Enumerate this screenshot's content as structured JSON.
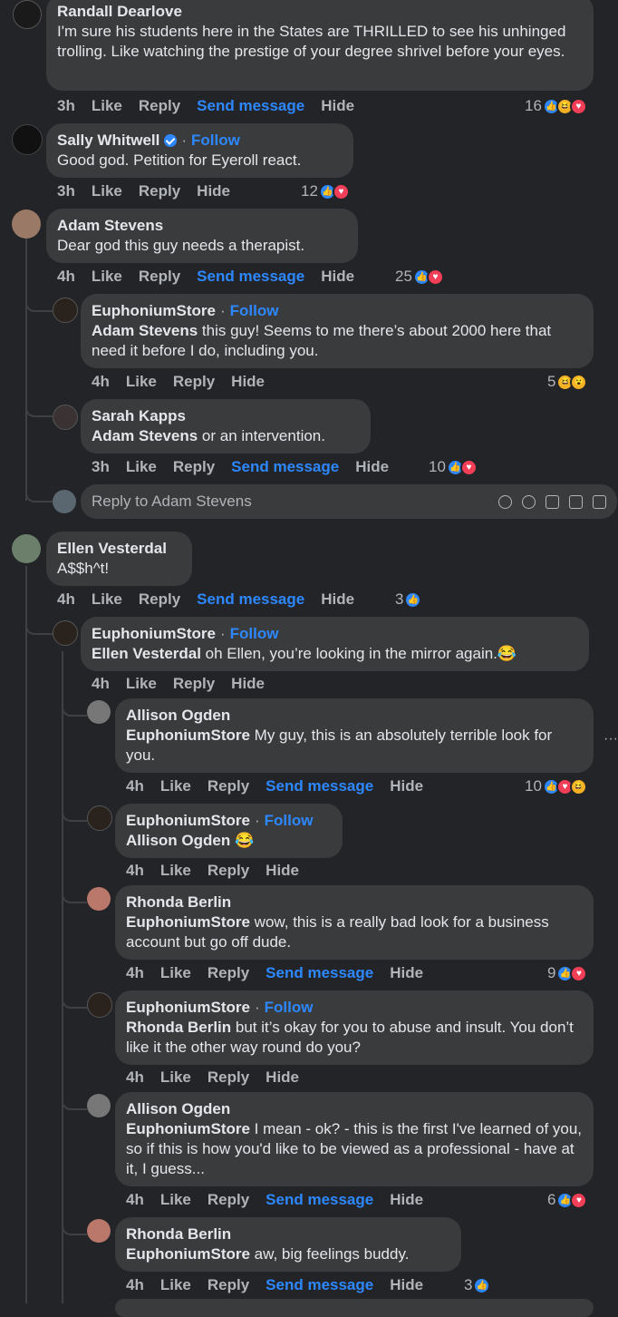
{
  "comments": [
    {
      "name": "Randall Dearlove",
      "text": "I'm sure his students here in the States are THRILLED to see his unhinged trolling. Like watching the prestige of your degree shrivel before your eyes.",
      "time": "3h",
      "like": "Like",
      "reply": "Reply",
      "send": "Send message",
      "hide": "Hide",
      "reactions": "16"
    },
    {
      "name": "Sally Whitwell",
      "follow": "Follow",
      "text": "Good god. Petition for Eyeroll react.",
      "time": "3h",
      "like": "Like",
      "reply": "Reply",
      "hide": "Hide",
      "reactions": "12"
    },
    {
      "name": "Adam Stevens",
      "text": "Dear god this guy needs a therapist.",
      "time": "4h",
      "like": "Like",
      "reply": "Reply",
      "send": "Send message",
      "hide": "Hide",
      "reactions": "25"
    },
    {
      "name": "EuphoniumStore",
      "follow": "Follow",
      "mention": "Adam Stevens",
      "text": " this guy! Seems to me there’s about 2000 here that need it before I do, including you.",
      "time": "4h",
      "like": "Like",
      "reply": "Reply",
      "hide": "Hide",
      "reactions": "5"
    },
    {
      "name": "Sarah Kapps",
      "mention": "Adam Stevens",
      "text": " or an intervention.",
      "time": "3h",
      "like": "Like",
      "reply": "Reply",
      "send": "Send message",
      "hide": "Hide",
      "reactions": "10"
    },
    {
      "name": "Ellen Vesterdal",
      "text": "A$$h^t!",
      "time": "4h",
      "like": "Like",
      "reply": "Reply",
      "send": "Send message",
      "hide": "Hide",
      "reactions": "3"
    },
    {
      "name": "EuphoniumStore",
      "follow": "Follow",
      "mention": "Ellen Vesterdal",
      "text": " oh Ellen, you’re looking in the mirror again.😂",
      "time": "4h",
      "like": "Like",
      "reply": "Reply",
      "hide": "Hide"
    },
    {
      "name": "Allison Ogden",
      "mention": "EuphoniumStore",
      "text": " My guy, this is an absolutely terrible look for you.",
      "time": "4h",
      "like": "Like",
      "reply": "Reply",
      "send": "Send message",
      "hide": "Hide",
      "reactions": "10"
    },
    {
      "name": "EuphoniumStore",
      "follow": "Follow",
      "mention": "Allison Ogden",
      "text": " 😂",
      "time": "4h",
      "like": "Like",
      "reply": "Reply",
      "hide": "Hide"
    },
    {
      "name": "Rhonda Berlin",
      "mention": "EuphoniumStore",
      "text": " wow, this is a really bad look for a business account but go off dude.",
      "time": "4h",
      "like": "Like",
      "reply": "Reply",
      "send": "Send message",
      "hide": "Hide",
      "reactions": "9"
    },
    {
      "name": "EuphoniumStore",
      "follow": "Follow",
      "mention": "Rhonda Berlin",
      "text": " but it’s okay for you to abuse and insult. You don’t like it the other way round do you?",
      "time": "4h",
      "like": "Like",
      "reply": "Reply",
      "hide": "Hide"
    },
    {
      "name": "Allison Ogden",
      "mention": "EuphoniumStore",
      "text": " I mean - ok? - this is the first I've learned of you, so if this is how you'd like to be viewed as a professional - have at it, I guess...",
      "time": "4h",
      "like": "Like",
      "reply": "Reply",
      "send": "Send message",
      "hide": "Hide",
      "reactions": "6"
    },
    {
      "name": "Rhonda Berlin",
      "mention": "EuphoniumStore",
      "text": " aw, big feelings buddy.",
      "time": "4h",
      "like": "Like",
      "reply": "Reply",
      "send": "Send message",
      "hide": "Hide",
      "reactions": "3"
    }
  ],
  "reply_box": {
    "placeholder": "Reply to Adam Stevens"
  },
  "dot_sep": "·",
  "colors": {
    "background": "#232427",
    "bubble": "#3a3b3c",
    "link": "#2d88ff",
    "like": "#2d88ff",
    "love": "#f33e58",
    "haha": "#f7b125"
  }
}
